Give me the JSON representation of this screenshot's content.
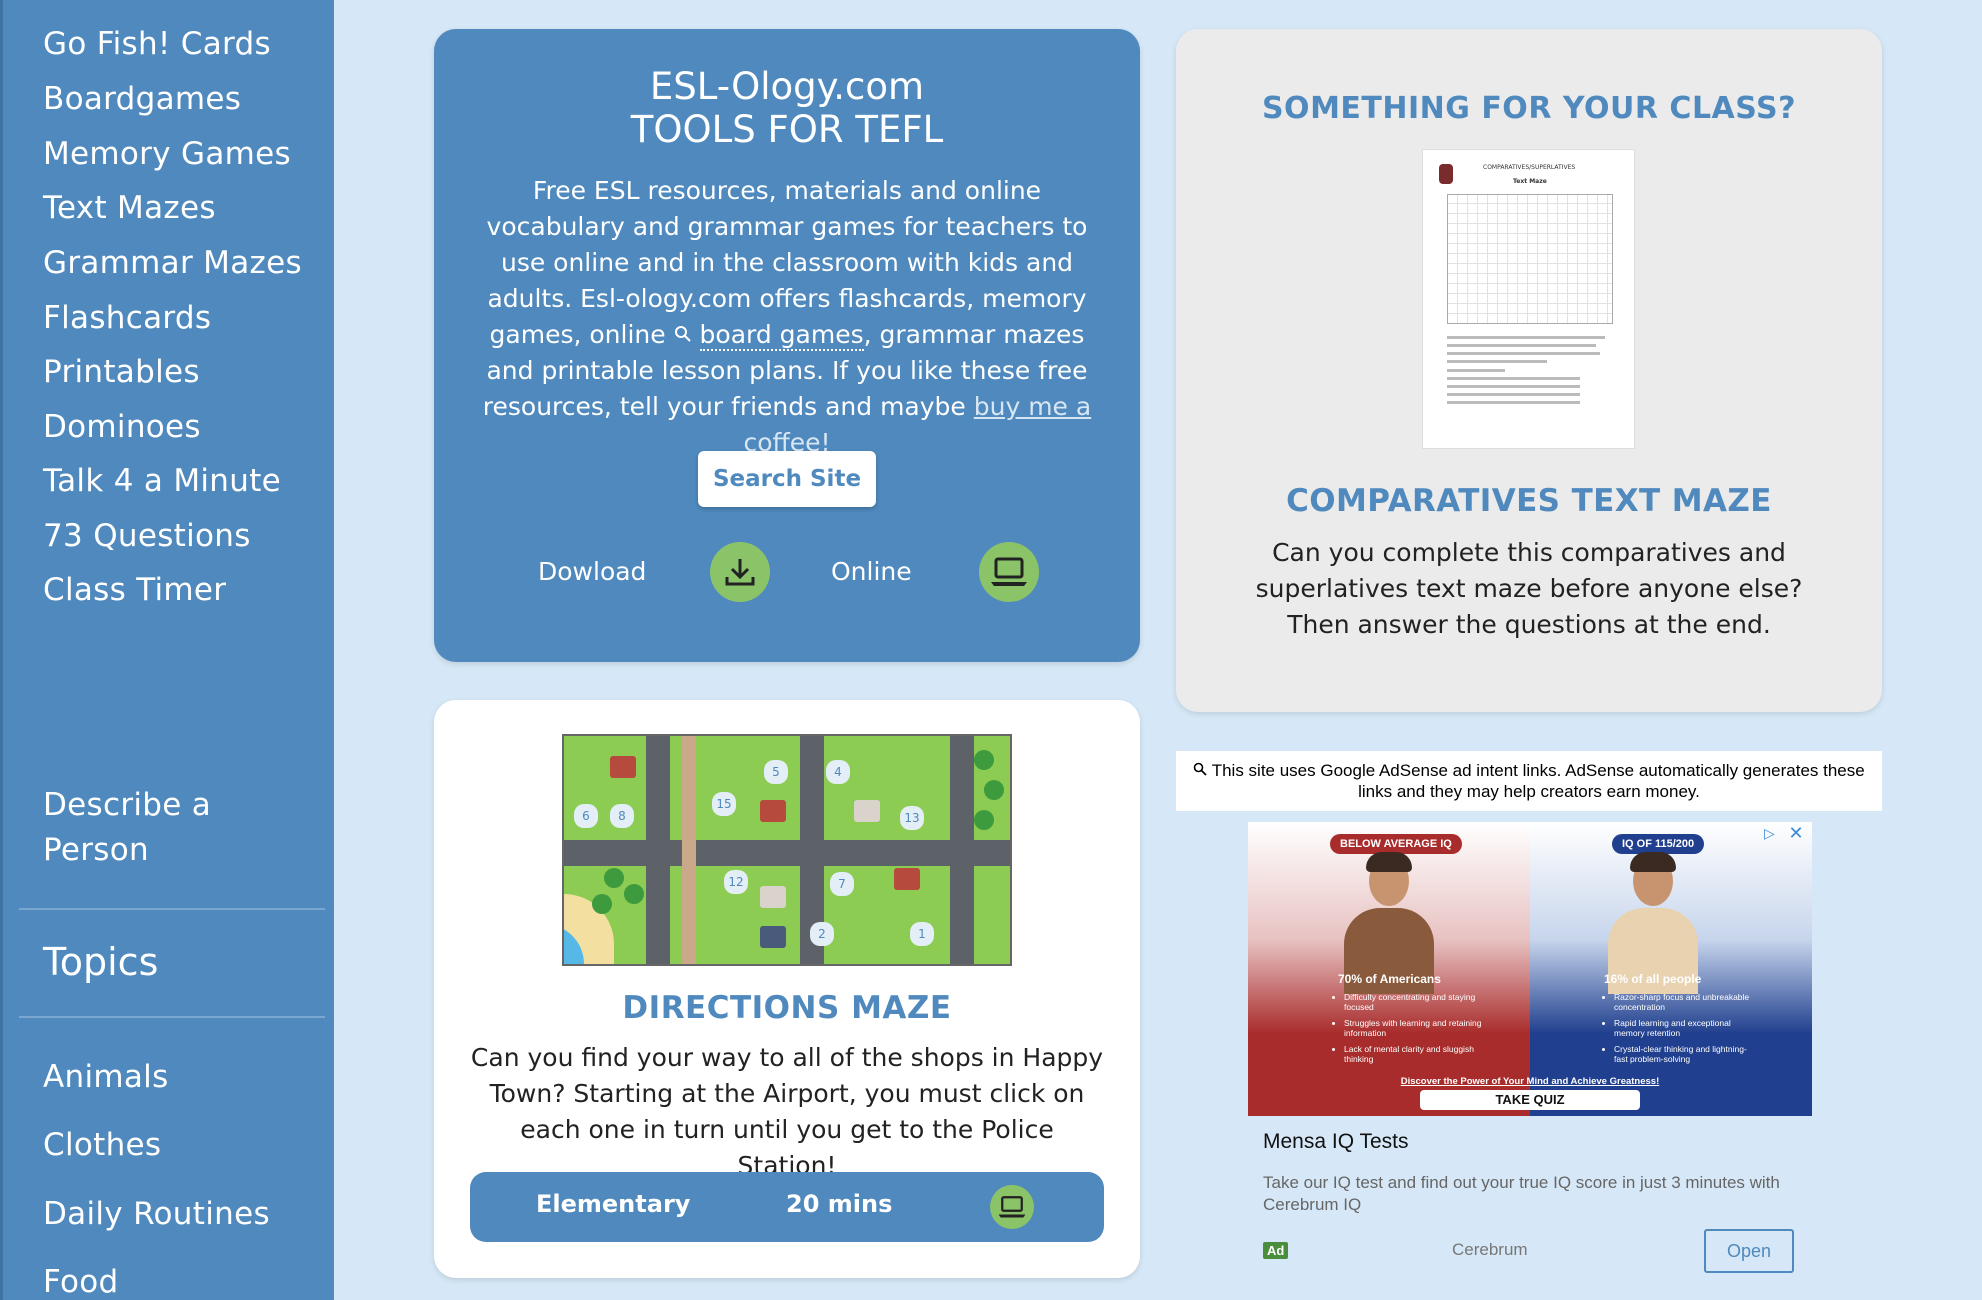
{
  "sidebar": {
    "items": [
      {
        "label": "Go Fish! Cards"
      },
      {
        "label": "Boardgames"
      },
      {
        "label": "Memory Games"
      },
      {
        "label": "Text Mazes"
      },
      {
        "label": "Grammar Mazes"
      },
      {
        "label": "Flashcards"
      },
      {
        "label": "Printables"
      },
      {
        "label": "Dominoes"
      },
      {
        "label": "Talk 4 a Minute"
      },
      {
        "label": "73 Questions"
      },
      {
        "label": "Class Timer"
      },
      {
        "label": "Describe a Person"
      }
    ],
    "topics_heading": "Topics",
    "topics": [
      {
        "label": "Animals"
      },
      {
        "label": "Clothes"
      },
      {
        "label": "Daily Routines"
      },
      {
        "label": "Food"
      }
    ]
  },
  "hero": {
    "title_line1": "ESL-Ology.com",
    "title_line2": "TOOLS FOR TEFL",
    "desc_part1": "Free ESL resources, materials and online vocabulary and grammar games for teachers to use online and in the classroom with kids and adults. Esl-ology.com offers flashcards, memory games, online ",
    "desc_link1": "board games",
    "desc_part2": ", grammar mazes and printable lesson plans. If you like these free resources, tell your friends and maybe ",
    "desc_link2": "buy me a coffee!",
    "search_button": "Search Site",
    "download_label": "Dowload",
    "online_label": "Online",
    "download_icon": "download-icon",
    "online_icon": "laptop-icon"
  },
  "featured": {
    "heading": "SOMETHING FOR YOUR CLASS?",
    "worksheet_title": "COMPARATIVES/SUPERLATIVES",
    "worksheet_subtitle": "Text Maze",
    "title": "COMPARATIVES TEXT MAZE",
    "description": "Can you complete this comparatives and superlatives text maze before anyone else? Then answer the questions at the end."
  },
  "maze": {
    "block_numbers": [
      "6",
      "8",
      "5",
      "15",
      "4",
      "13",
      "12",
      "7",
      "2",
      "1"
    ],
    "title": "DIRECTIONS MAZE",
    "description": "Can you find your way to all of the shops in Happy Town? Starting at the Airport, you must click on each one in turn until you get to the Police Station!",
    "level": "Elementary",
    "duration": "20 mins",
    "mode_icon": "laptop-icon"
  },
  "adsense_notice": "This site uses Google AdSense ad intent links. AdSense automatically generates these links and they may help creators earn money.",
  "ad": {
    "left_badge": "BELOW AVERAGE IQ",
    "right_badge": "IQ OF 115/200",
    "left_stat": "70% of Americans",
    "right_stat": "16% of all people",
    "left_bullets": [
      "Difficulty concentrating and staying focused",
      "Struggles with learning and retaining information",
      "Lack of mental clarity and sluggish thinking"
    ],
    "right_bullets": [
      "Razor-sharp focus and unbreakable concentration",
      "Rapid learning and exceptional memory retention",
      "Crystal-clear thinking and lightning-fast problem-solving"
    ],
    "discover": "Discover the Power of Your Mind and Achieve Greatness!",
    "quiz": "TAKE QUIZ",
    "title": "Mensa IQ Tests",
    "text": "Take our IQ test and find out your true IQ score in just 3 minutes with Cerebrum IQ",
    "tag": "Ad",
    "advertiser": "Cerebrum",
    "open": "Open",
    "colors": {
      "left": "#a92c2c",
      "right": "#203f8e"
    }
  },
  "colors": {
    "accent": "#4f89bd",
    "background": "#d6e8f7",
    "icon_green": "#8bc468"
  }
}
